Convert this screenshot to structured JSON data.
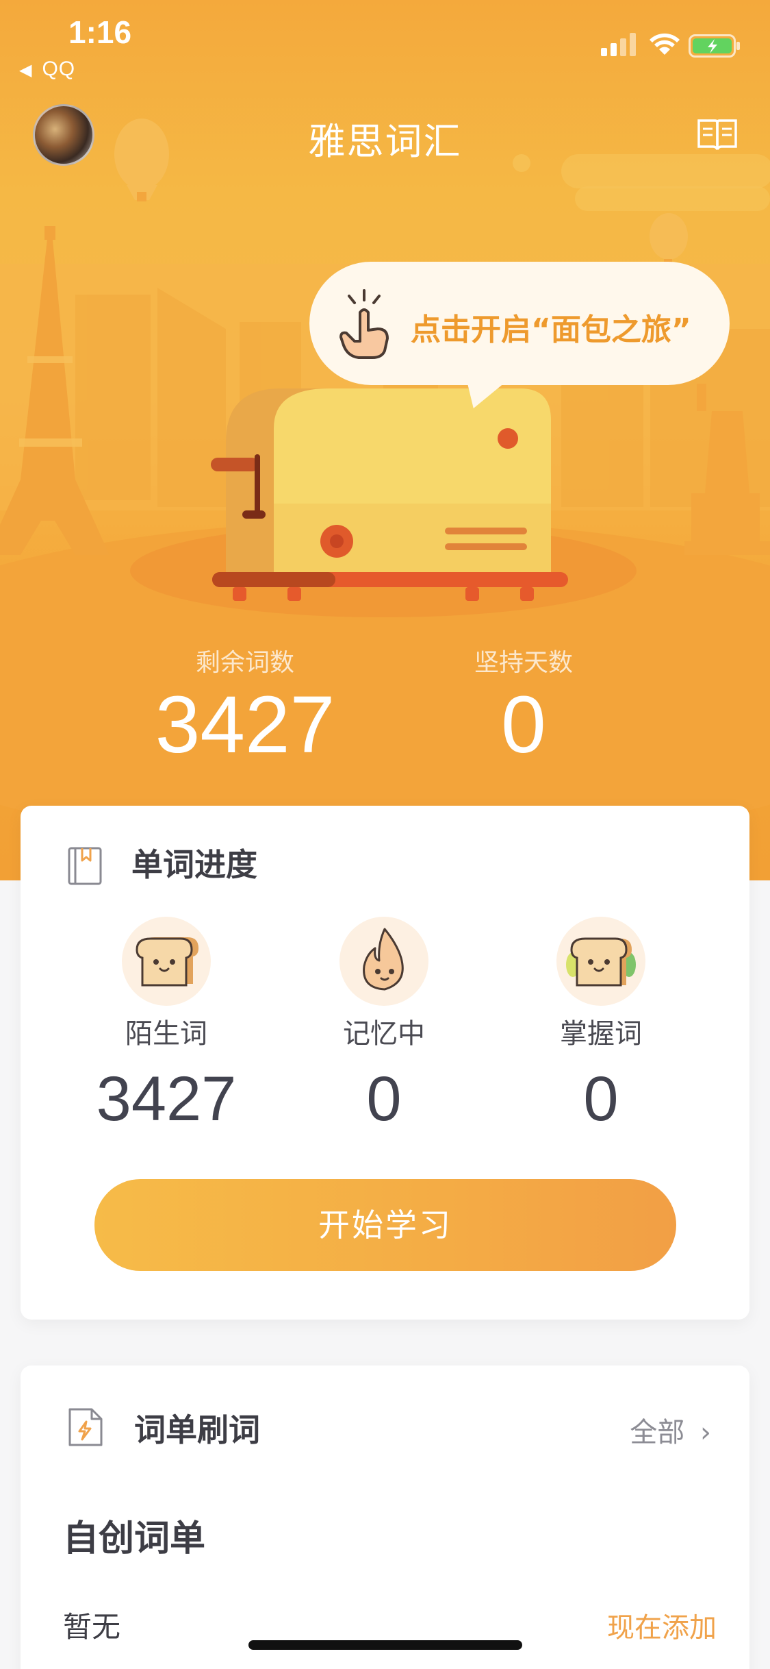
{
  "status_bar": {
    "time": "1:16",
    "back_app": "QQ"
  },
  "header": {
    "title": "雅思词汇",
    "avatar_icon": "user-avatar",
    "book_icon": "open-book-icon"
  },
  "bubble": {
    "text": "点击开启“面包之旅”",
    "icon": "tap-hand-icon"
  },
  "stats": {
    "remaining_label": "剩余词数",
    "remaining_value": "3427",
    "streak_label": "坚持天数",
    "streak_value": "0"
  },
  "progress_card": {
    "title": "单词进度",
    "icon": "bookmark-book-icon",
    "columns": [
      {
        "label": "陌生词",
        "value": "3427",
        "icon": "toast-face-icon"
      },
      {
        "label": "记忆中",
        "value": "0",
        "icon": "flame-face-icon"
      },
      {
        "label": "掌握词",
        "value": "0",
        "icon": "sandwich-face-icon"
      }
    ],
    "start_button": "开始学习"
  },
  "wordlist_card": {
    "title": "词单刷词",
    "icon": "lightning-doc-icon",
    "all_link": "全部",
    "section_title": "自创词单",
    "empty_text": "暂无",
    "add_link": "现在添加"
  },
  "colors": {
    "hero_orange": "#f4a93c",
    "accent_orange": "#f0a24a",
    "text_dark": "#3d3d45"
  }
}
